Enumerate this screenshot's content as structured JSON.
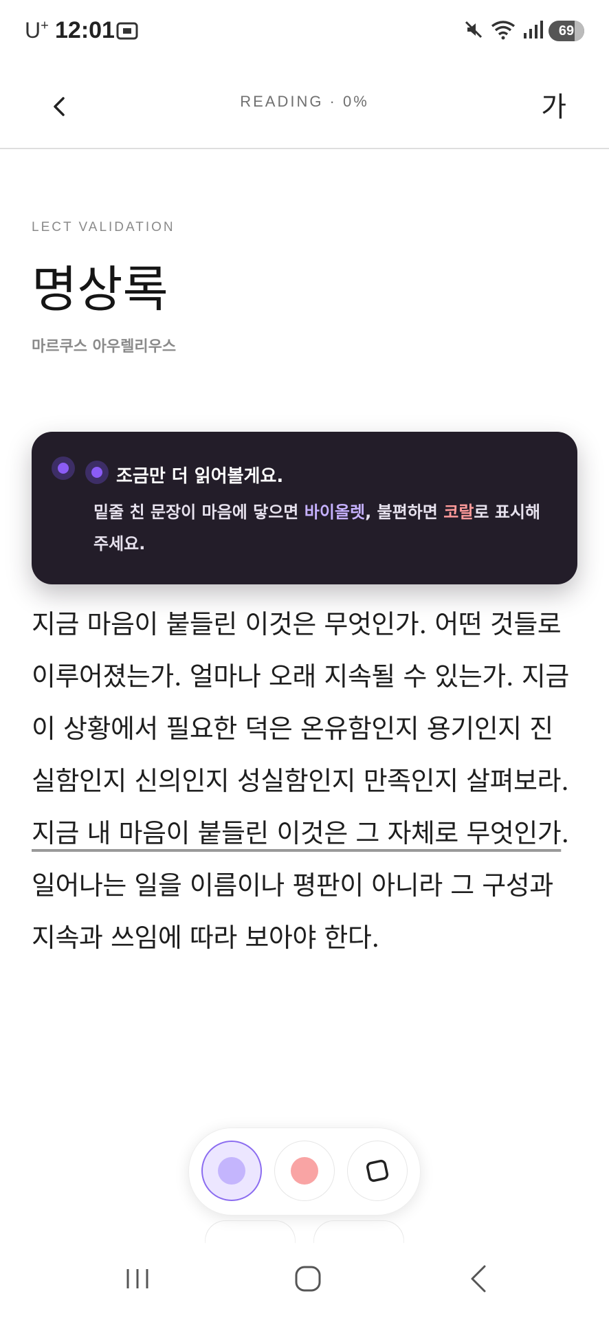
{
  "status_bar": {
    "carrier": "U",
    "carrier_sup": "+",
    "time": "12:01",
    "battery": "69",
    "icons": [
      "screenshot-icon",
      "mute-icon",
      "wifi-icon",
      "signal-icon",
      "battery-icon"
    ]
  },
  "header": {
    "reading_label": "READING · 0%",
    "font_button": "가"
  },
  "book": {
    "eyebrow": "LECT VALIDATION",
    "title": "명상록",
    "author": "마르쿠스 아우렐리우스"
  },
  "tooltip": {
    "title": "조금만 더 읽어볼게요.",
    "body_part1": "밑줄 친 문장이 마음에 닿으면 ",
    "body_violet": "바이올렛",
    "body_part2": ", 불편하면 ",
    "body_coral": "코랄",
    "body_part3": "로 표시해 주세요."
  },
  "passage": {
    "before": "지금 마음이 붙들린 이것은 무엇인가. 어떤 것들로 이루어졌는가. 얼마나 오래 지속될 수 있는가. 지금 이 상황에서 필요한 덕은 온유함인지 용기인지 진실함인지 신의인지 성실함인지 만족인지 살펴보라. ",
    "underlined": "지금 내 마음이 붙들린 이것은 그 자체로 무엇인가",
    "after": ". 일어나는 일을 이름이나 평판이 아니라 그 구성과 지속과 쓰임에 따라 보아야 한다."
  },
  "toolbar": {
    "tools": [
      "violet",
      "coral",
      "eraser"
    ],
    "selected": "violet"
  },
  "colors": {
    "violet": "#8b6cf0",
    "coral": "#f9a4a4",
    "tooltip_bg": "#231d29"
  }
}
